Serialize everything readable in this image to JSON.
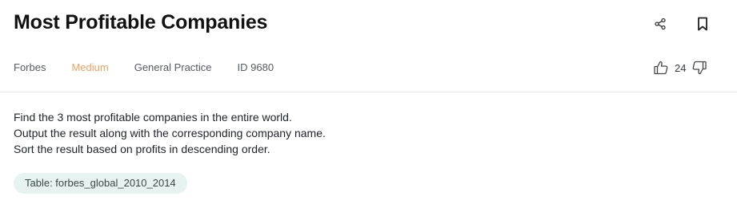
{
  "question": {
    "title": "Most Profitable Companies",
    "company": "Forbes",
    "difficulty": "Medium",
    "category": "General Practice",
    "id_label": "ID 9680",
    "upvotes": "24",
    "description_lines": [
      "Find the 3 most profitable companies in the entire world.",
      "Output the result along with the corresponding company name.",
      "Sort the result based on profits in descending order."
    ],
    "table_label": "Table: forbes_global_2010_2014"
  },
  "icons": {
    "share": "share-icon",
    "bookmark": "bookmark-icon",
    "thumbs_up": "thumbs-up-icon",
    "thumbs_down": "thumbs-down-icon"
  },
  "colors": {
    "difficulty_medium": "#f0a060",
    "chip_background": "#e6f3f1"
  }
}
